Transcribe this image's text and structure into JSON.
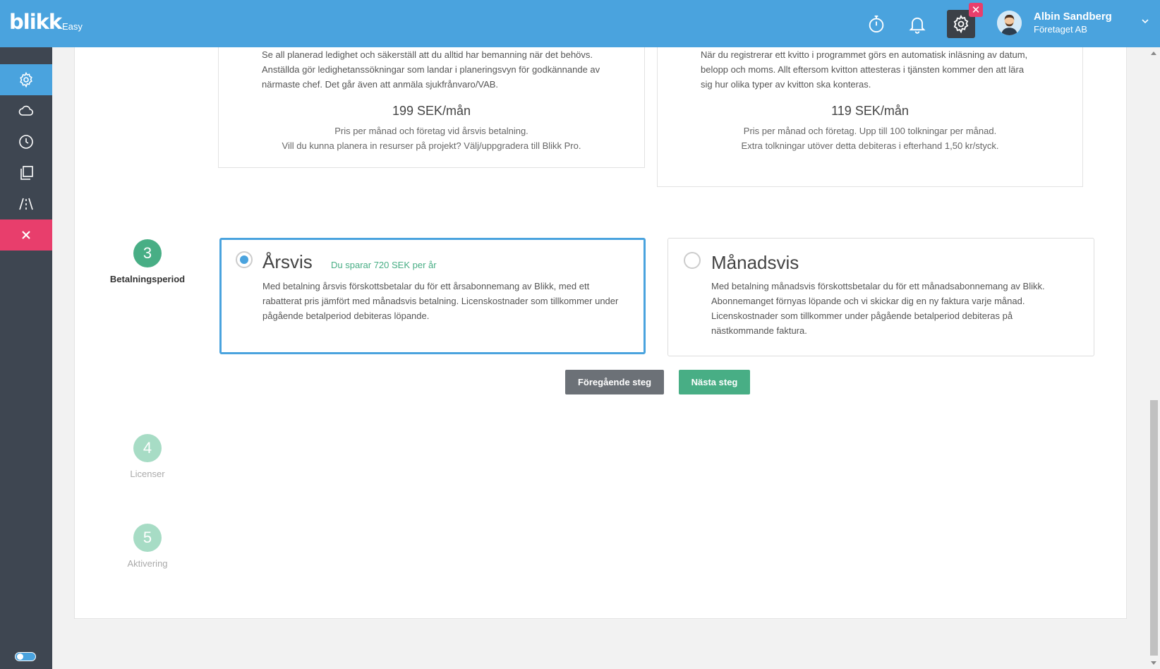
{
  "app": {
    "logo": "blikk",
    "logo_sub": "Easy"
  },
  "header": {
    "icons": [
      "stopwatch-icon",
      "bell-icon",
      "gear-icon"
    ],
    "gear_badge": "✕",
    "user_name": "Albin Sandberg",
    "user_company": "Företaget AB"
  },
  "sidebar": {
    "items": [
      "gear-icon",
      "cloud-icon",
      "clock-icon",
      "copy-icon",
      "road-icon",
      "close-icon"
    ],
    "accent": "#4aa3de",
    "close_color": "#e83e6c"
  },
  "top_cards": [
    {
      "desc": "Se all planerad ledighet och säkerställ att du alltid har bemanning när det behövs. Anställda gör ledighetanssökningar som landar i planeringsvyn för godkännande av närmaste chef. Det går även att anmäla sjukfrånvaro/VAB.",
      "price": "199 SEK/mån",
      "note1": "Pris per månad och företag vid årsvis betalning.",
      "note2": "Vill du kunna planera in resurser på projekt? Välj/uppgradera till Blikk Pro."
    },
    {
      "desc": "När du registrerar ett kvitto i programmet görs en automatisk inläsning av datum, belopp och moms. Allt eftersom kvitton attesteras i tjänsten kommer den att lära sig hur olika typer av kvitton ska konteras.",
      "price": "119 SEK/mån",
      "note1": "Pris per månad och företag. Upp till 100 tolkningar per månad.",
      "note2": "Extra tolkningar utöver detta debiteras i efterhand 1,50 kr/styck."
    }
  ],
  "steps": [
    {
      "number": "3",
      "label": "Betalningsperiod",
      "state": "active"
    },
    {
      "number": "4",
      "label": "Licenser",
      "state": "pending"
    },
    {
      "number": "5",
      "label": "Aktivering",
      "state": "pending"
    }
  ],
  "payment_options": [
    {
      "title": "Årsvis",
      "savings": "Du sparar 720 SEK per år",
      "selected": true,
      "desc": "Med betalning årsvis förskottsbetalar du för ett årsabonnemang av Blikk, med ett rabatterat pris jämfört med månadsvis betalning. Licenskostnader som tillkommer under pågående betalperiod debiteras löpande."
    },
    {
      "title": "Månadsvis",
      "savings": "",
      "selected": false,
      "desc": "Med betalning månadsvis förskottsbetalar du för ett månadsabonnemang av Blikk. Abonnemanget förnyas löpande och vi skickar dig en ny faktura varje månad. Licenskostnader som tillkommer under pågående betalperiod debiteras på nästkommande faktura."
    }
  ],
  "buttons": {
    "prev": "Föregående steg",
    "next": "Nästa steg"
  }
}
